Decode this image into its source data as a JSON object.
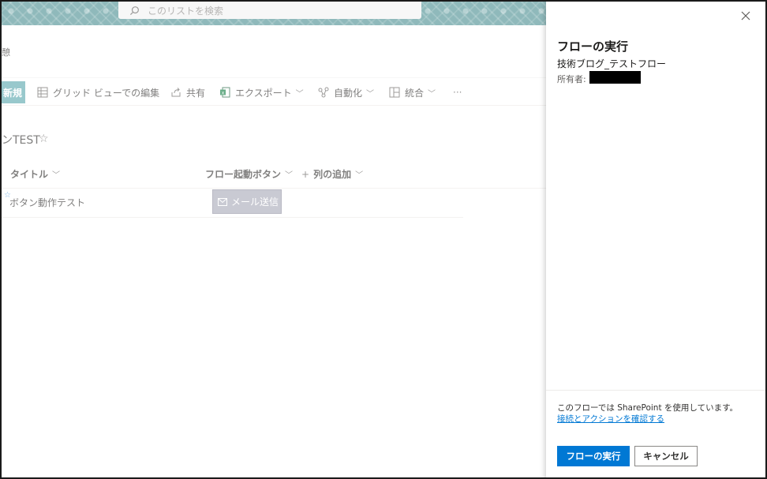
{
  "header": {
    "search_placeholder": "このリストを検索",
    "site_fragment": "憩"
  },
  "commandbar": {
    "new_label": "新規",
    "grid_edit_label": "グリッド ビューでの編集",
    "share_label": "共有",
    "export_label": "エクスポート",
    "automate_label": "自動化",
    "integrate_label": "統合",
    "more_label": "···"
  },
  "list": {
    "title": "ンTEST",
    "star": "☆",
    "columns": [
      "タイトル",
      "フロー起動ボタン",
      "列の追加"
    ],
    "add_column_prefix": "+",
    "rows": [
      {
        "new_marker": "☆",
        "title": "ボタン動作テスト",
        "button_label": "メール送信"
      }
    ]
  },
  "panel": {
    "title": "フローの実行",
    "flow_name": "技術ブログ_テストフロー",
    "owner_label": "所有者:",
    "note": "このフローでは SharePoint を使用しています。",
    "link": "接続とアクションを確認する",
    "run_button": "フローの実行",
    "cancel_button": "キャンセル"
  },
  "colors": {
    "accent": "#0078d4",
    "new_button": "#5aa6ad",
    "mail_button": "#a9aab9"
  }
}
